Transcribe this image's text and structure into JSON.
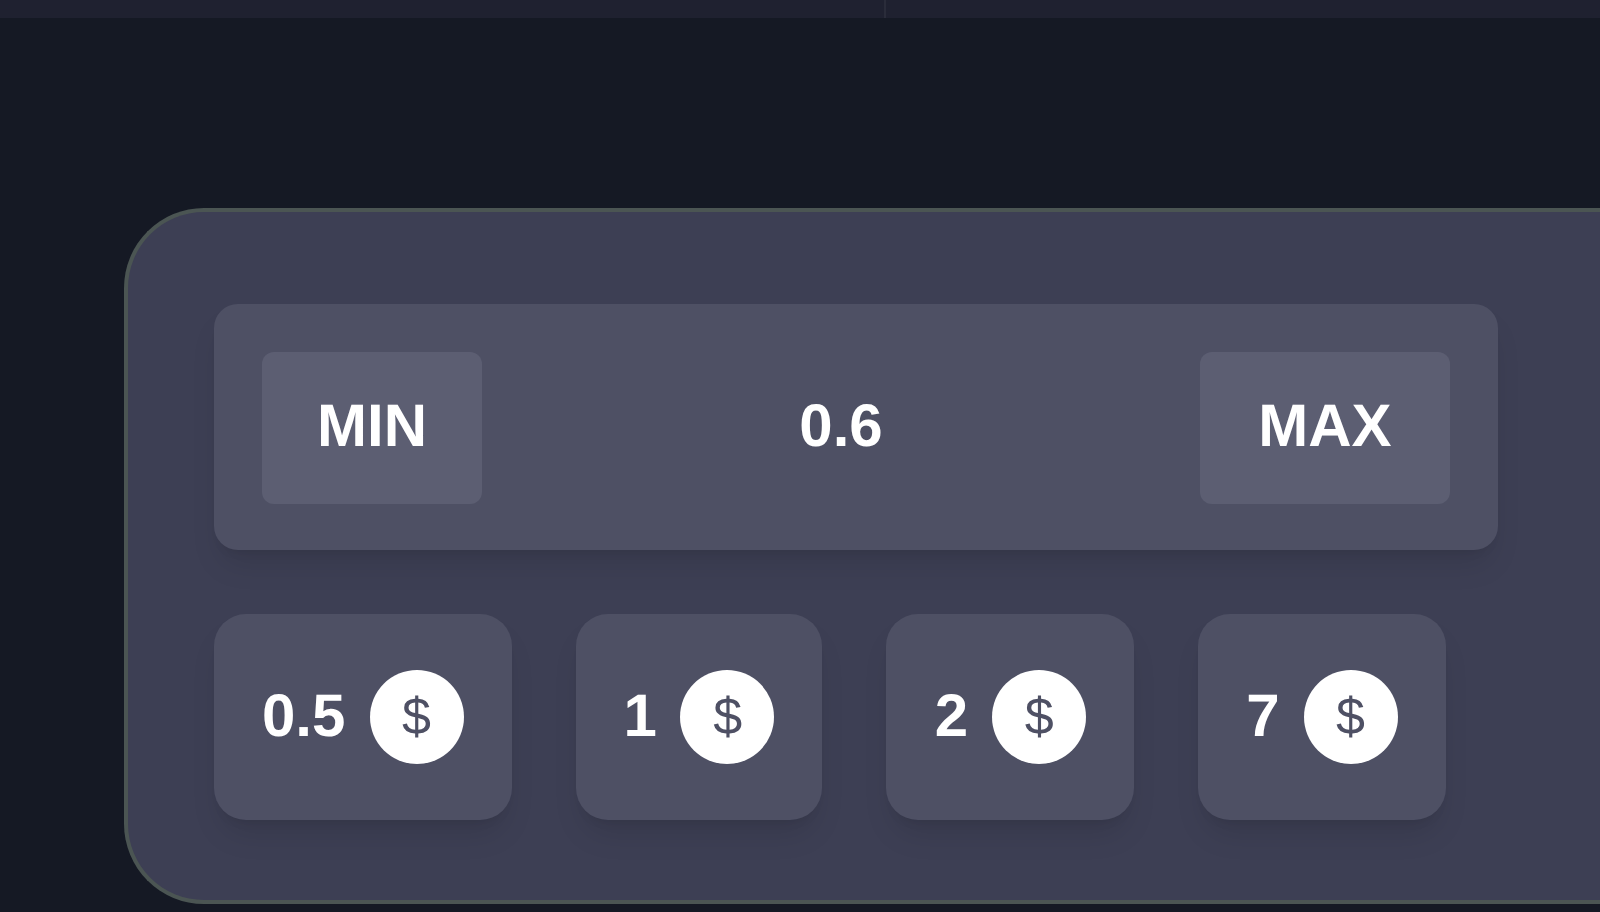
{
  "bet_input": {
    "min_label": "MIN",
    "value": "0.6",
    "max_label": "MAX"
  },
  "chips": [
    {
      "amount": "0.5",
      "currency": "$"
    },
    {
      "amount": "1",
      "currency": "$"
    },
    {
      "amount": "2",
      "currency": "$"
    },
    {
      "amount": "7",
      "currency": "$"
    }
  ]
}
